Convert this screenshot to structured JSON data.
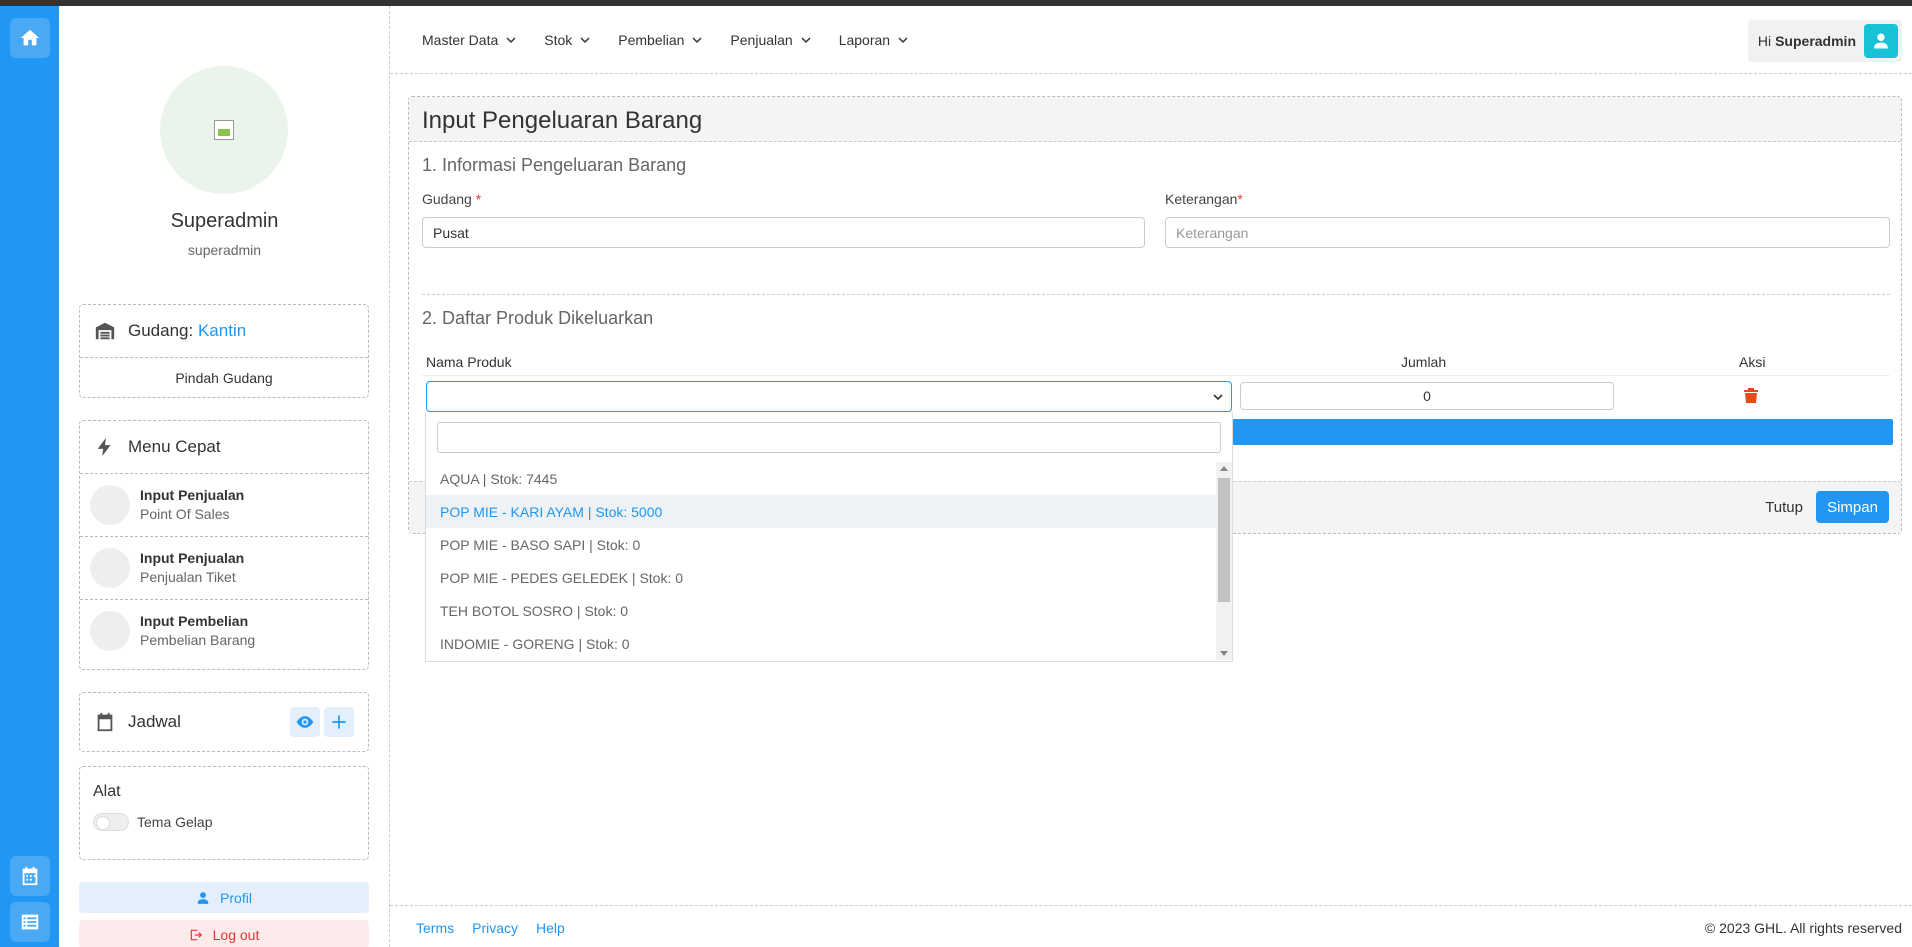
{
  "sidebar": {
    "name": "Superadmin",
    "username": "superadmin",
    "warehouse": {
      "label": "Gudang:",
      "value": "Kantin",
      "move_label": "Pindah Gudang"
    },
    "quick_menu": {
      "title": "Menu Cepat",
      "items": [
        {
          "title": "Input Penjualan",
          "subtitle": "Point Of Sales"
        },
        {
          "title": "Input Penjualan",
          "subtitle": "Penjualan Tiket"
        },
        {
          "title": "Input Pembelian",
          "subtitle": "Pembelian Barang"
        }
      ]
    },
    "schedule": {
      "title": "Jadwal"
    },
    "tools": {
      "title": "Alat",
      "dark_theme_label": "Tema Gelap",
      "dark_theme_on": false
    },
    "profile_label": "Profil",
    "logout_label": "Log out"
  },
  "nav": {
    "items": [
      "Master Data",
      "Stok",
      "Pembelian",
      "Penjualan",
      "Laporan"
    ],
    "greeting": "Hi",
    "user": "Superadmin"
  },
  "form": {
    "title": "Input Pengeluaran Barang",
    "section1_title": "1. Informasi Pengeluaran Barang",
    "gudang_label": "Gudang",
    "gudang_value": "Pusat",
    "keterangan_label": "Keterangan",
    "keterangan_placeholder": "Keterangan",
    "required_mark": "*",
    "section2_title": "2. Daftar Produk Dikeluarkan",
    "columns": {
      "product": "Nama Produk",
      "qty": "Jumlah",
      "action": "Aksi"
    },
    "row": {
      "product": "",
      "qty": "0"
    },
    "close_label": "Tutup",
    "save_label": "Simpan"
  },
  "dropdown": {
    "search_value": "",
    "options": [
      "AQUA | Stok: 7445",
      "POP MIE - KARI AYAM | Stok: 5000",
      "POP MIE - BASO SAPI | Stok: 0",
      "POP MIE - PEDES GELEDEK | Stok: 0",
      "TEH BOTOL SOSRO | Stok: 0",
      "INDOMIE - GORENG | Stok: 0"
    ],
    "highlighted_index": 1
  },
  "footer": {
    "links": [
      "Terms",
      "Privacy",
      "Help"
    ],
    "copyright": "2023 GHL. All rights reserved"
  },
  "colors": {
    "primary": "#2196f3",
    "danger": "#e53935",
    "teal": "#17c1d6"
  }
}
